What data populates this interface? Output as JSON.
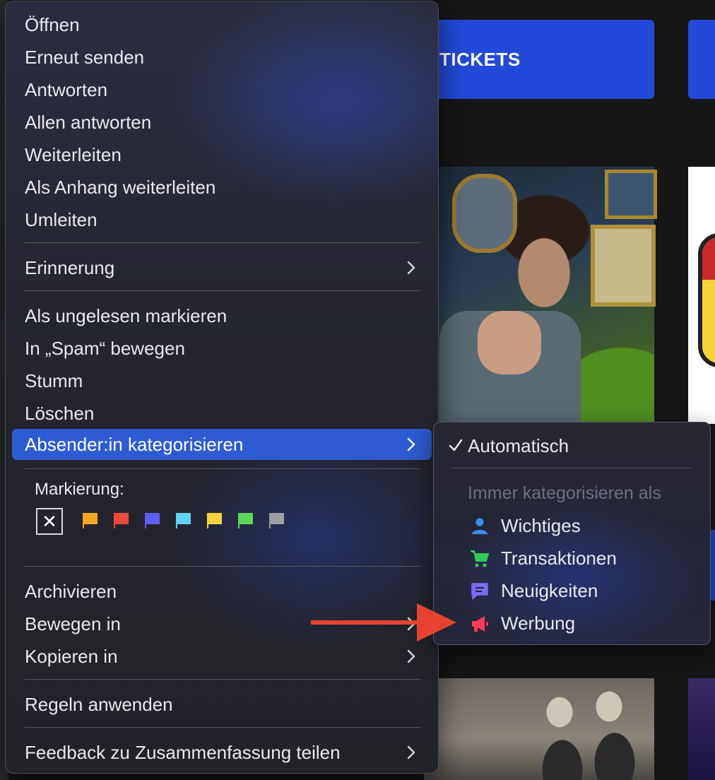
{
  "background": {
    "ticket_button_label": "TICKETS"
  },
  "menu": {
    "groups": [
      [
        "Öffnen",
        "Erneut senden",
        "Antworten",
        "Allen antworten",
        "Weiterleiten",
        "Als Anhang weiterleiten",
        "Umleiten"
      ]
    ],
    "items": {
      "open": "Öffnen",
      "resend": "Erneut senden",
      "reply": "Antworten",
      "reply_all": "Allen antworten",
      "forward": "Weiterleiten",
      "forward_attachment": "Als Anhang weiterleiten",
      "redirect": "Umleiten",
      "reminder": "Erinnerung",
      "mark_unread": "Als ungelesen markieren",
      "move_spam": "In „Spam“ bewegen",
      "mute": "Stumm",
      "delete": "Löschen",
      "categorize_sender": "Absender:in kategorisieren",
      "archive": "Archivieren",
      "move_to": "Bewegen in",
      "copy_to": "Kopieren in",
      "apply_rules": "Regeln anwenden",
      "feedback_summary": "Feedback zu Zusammenfassung teilen"
    },
    "markierung": {
      "label": "Markierung:",
      "clear_symbol": "✕",
      "flag_colors": [
        "#f5a623",
        "#f0493e",
        "#5b5ef2",
        "#5fd3f3",
        "#f7d23e",
        "#5ed65a",
        "#9e9ea3"
      ]
    }
  },
  "submenu": {
    "automatic": "Automatisch",
    "heading": "Immer kategorisieren als",
    "categories": [
      {
        "label": "Wichtiges",
        "icon": "person-icon",
        "color": "#3d8bff"
      },
      {
        "label": "Transaktionen",
        "icon": "cart-icon",
        "color": "#34c759"
      },
      {
        "label": "Neuigkeiten",
        "icon": "message-icon",
        "color": "#7a6cf0"
      },
      {
        "label": "Werbung",
        "icon": "megaphone-icon",
        "color": "#ff3b5c"
      }
    ]
  },
  "colors": {
    "accent": "#2f5bd2",
    "arrow": "#e8412f"
  }
}
